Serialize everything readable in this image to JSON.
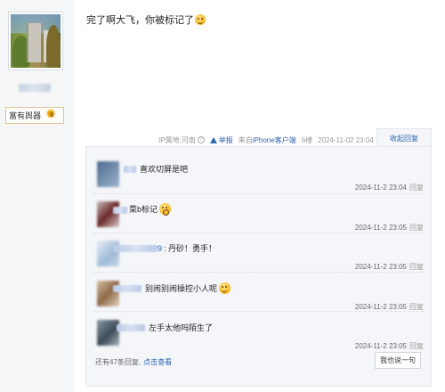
{
  "poster": {
    "avatar_icon": "user-avatar-photo",
    "username": "",
    "title_badge": "富有舆器",
    "level_icon": "sun-level-icon",
    "level": "8"
  },
  "post": {
    "text": "完了啊大飞，你被标记了",
    "emoji_icon": "sweat-smile-emoji"
  },
  "meta": {
    "ip_location": "IP属地:河南",
    "report": "举报",
    "source_prefix": "来自",
    "source_link": "iPhone客户端",
    "floor": "6楼",
    "datetime": "2024-11-02 23:04",
    "collapse_reply": "收起回复"
  },
  "replies": [
    {
      "name_tail": "",
      "text": "喜欢切屏是吧",
      "time": "2024-11-2 23:04",
      "reply_label": "回复",
      "avatar_color": "#6b86a8",
      "emoji": ""
    },
    {
      "name_tail": "",
      "text": "菜b标记",
      "time": "2024-11-2 23:05",
      "reply_label": "回复",
      "avatar_color": "#8a4a4a",
      "emoji": "surprised-emoji"
    },
    {
      "name_tail": "9",
      "text": ": 丹砂！勇手！",
      "time": "2024-11-2 23:05",
      "reply_label": "回复",
      "avatar_color": "#a9c4dc",
      "emoji": ""
    },
    {
      "name_tail": "",
      "text": "别闹别闹操控小人呢",
      "time": "2024-11-2 23:05",
      "reply_label": "回复",
      "avatar_color": "#b89a78",
      "emoji": "smile-emoji"
    },
    {
      "name_tail": "",
      "text": "左手太他吗陌生了",
      "time": "2024-11-2 23:05",
      "reply_label": "回复",
      "avatar_color": "#5a6b78",
      "emoji": ""
    }
  ],
  "footer": {
    "more_replies": "还有47条回复,",
    "view_link": "点击查看",
    "say_button": "我也说一句"
  }
}
